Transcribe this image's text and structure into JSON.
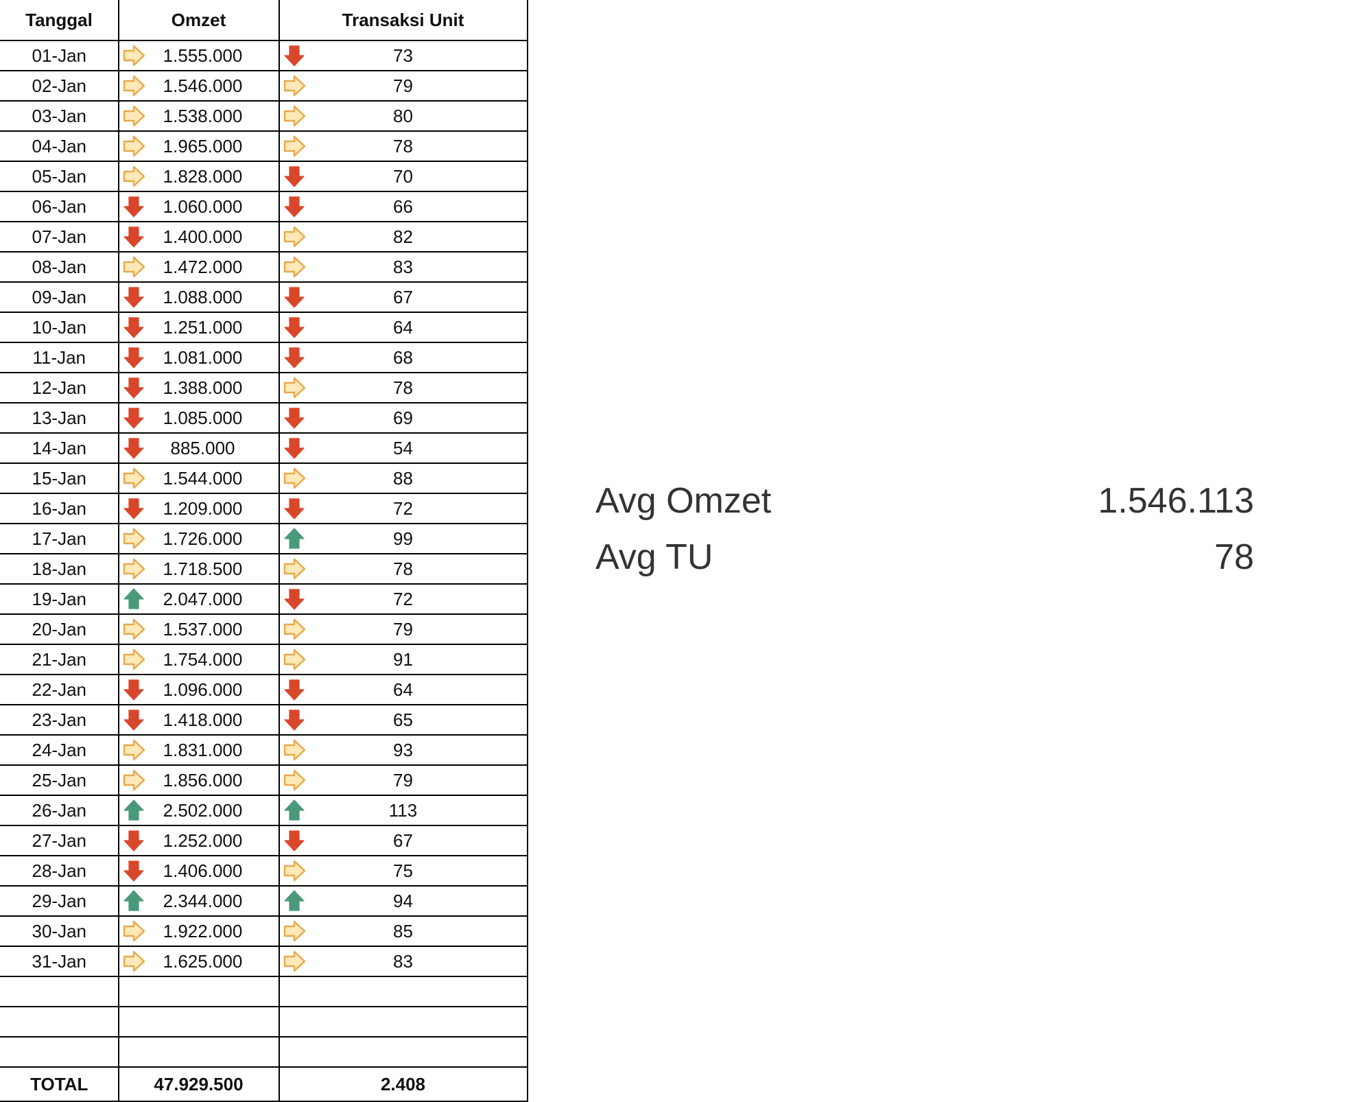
{
  "table": {
    "headers": {
      "date": "Tanggal",
      "omzet": "Omzet",
      "tu": "Transaksi Unit"
    },
    "rows": [
      {
        "date": "01-Jan",
        "omzet": "1.555.000",
        "omzet_trend": "side",
        "tu": "73",
        "tu_trend": "down"
      },
      {
        "date": "02-Jan",
        "omzet": "1.546.000",
        "omzet_trend": "side",
        "tu": "79",
        "tu_trend": "side"
      },
      {
        "date": "03-Jan",
        "omzet": "1.538.000",
        "omzet_trend": "side",
        "tu": "80",
        "tu_trend": "side"
      },
      {
        "date": "04-Jan",
        "omzet": "1.965.000",
        "omzet_trend": "side",
        "tu": "78",
        "tu_trend": "side"
      },
      {
        "date": "05-Jan",
        "omzet": "1.828.000",
        "omzet_trend": "side",
        "tu": "70",
        "tu_trend": "down"
      },
      {
        "date": "06-Jan",
        "omzet": "1.060.000",
        "omzet_trend": "down",
        "tu": "66",
        "tu_trend": "down"
      },
      {
        "date": "07-Jan",
        "omzet": "1.400.000",
        "omzet_trend": "down",
        "tu": "82",
        "tu_trend": "side"
      },
      {
        "date": "08-Jan",
        "omzet": "1.472.000",
        "omzet_trend": "side",
        "tu": "83",
        "tu_trend": "side"
      },
      {
        "date": "09-Jan",
        "omzet": "1.088.000",
        "omzet_trend": "down",
        "tu": "67",
        "tu_trend": "down"
      },
      {
        "date": "10-Jan",
        "omzet": "1.251.000",
        "omzet_trend": "down",
        "tu": "64",
        "tu_trend": "down"
      },
      {
        "date": "11-Jan",
        "omzet": "1.081.000",
        "omzet_trend": "down",
        "tu": "68",
        "tu_trend": "down"
      },
      {
        "date": "12-Jan",
        "omzet": "1.388.000",
        "omzet_trend": "down",
        "tu": "78",
        "tu_trend": "side"
      },
      {
        "date": "13-Jan",
        "omzet": "1.085.000",
        "omzet_trend": "down",
        "tu": "69",
        "tu_trend": "down"
      },
      {
        "date": "14-Jan",
        "omzet": "885.000",
        "omzet_trend": "down",
        "tu": "54",
        "tu_trend": "down"
      },
      {
        "date": "15-Jan",
        "omzet": "1.544.000",
        "omzet_trend": "side",
        "tu": "88",
        "tu_trend": "side"
      },
      {
        "date": "16-Jan",
        "omzet": "1.209.000",
        "omzet_trend": "down",
        "tu": "72",
        "tu_trend": "down"
      },
      {
        "date": "17-Jan",
        "omzet": "1.726.000",
        "omzet_trend": "side",
        "tu": "99",
        "tu_trend": "up"
      },
      {
        "date": "18-Jan",
        "omzet": "1.718.500",
        "omzet_trend": "side",
        "tu": "78",
        "tu_trend": "side"
      },
      {
        "date": "19-Jan",
        "omzet": "2.047.000",
        "omzet_trend": "up",
        "tu": "72",
        "tu_trend": "down"
      },
      {
        "date": "20-Jan",
        "omzet": "1.537.000",
        "omzet_trend": "side",
        "tu": "79",
        "tu_trend": "side"
      },
      {
        "date": "21-Jan",
        "omzet": "1.754.000",
        "omzet_trend": "side",
        "tu": "91",
        "tu_trend": "side"
      },
      {
        "date": "22-Jan",
        "omzet": "1.096.000",
        "omzet_trend": "down",
        "tu": "64",
        "tu_trend": "down"
      },
      {
        "date": "23-Jan",
        "omzet": "1.418.000",
        "omzet_trend": "down",
        "tu": "65",
        "tu_trend": "down"
      },
      {
        "date": "24-Jan",
        "omzet": "1.831.000",
        "omzet_trend": "side",
        "tu": "93",
        "tu_trend": "side"
      },
      {
        "date": "25-Jan",
        "omzet": "1.856.000",
        "omzet_trend": "side",
        "tu": "79",
        "tu_trend": "side"
      },
      {
        "date": "26-Jan",
        "omzet": "2.502.000",
        "omzet_trend": "up",
        "tu": "113",
        "tu_trend": "up"
      },
      {
        "date": "27-Jan",
        "omzet": "1.252.000",
        "omzet_trend": "down",
        "tu": "67",
        "tu_trend": "down"
      },
      {
        "date": "28-Jan",
        "omzet": "1.406.000",
        "omzet_trend": "down",
        "tu": "75",
        "tu_trend": "side"
      },
      {
        "date": "29-Jan",
        "omzet": "2.344.000",
        "omzet_trend": "up",
        "tu": "94",
        "tu_trend": "up"
      },
      {
        "date": "30-Jan",
        "omzet": "1.922.000",
        "omzet_trend": "side",
        "tu": "85",
        "tu_trend": "side"
      },
      {
        "date": "31-Jan",
        "omzet": "1.625.000",
        "omzet_trend": "side",
        "tu": "83",
        "tu_trend": "side"
      }
    ],
    "empty_rows": 3,
    "total": {
      "label": "TOTAL",
      "omzet": "47.929.500",
      "tu": "2.408"
    }
  },
  "summary": {
    "avg_omzet_label": "Avg Omzet",
    "avg_omzet_value": "1.546.113",
    "avg_tu_label": "Avg TU",
    "avg_tu_value": "78"
  },
  "icons": {
    "up": {
      "name": "arrow-up-icon",
      "color": "#4a9a7a"
    },
    "side": {
      "name": "arrow-right-icon",
      "color": "#e9a84a"
    },
    "down": {
      "name": "arrow-down-icon",
      "color": "#d9472b"
    }
  }
}
